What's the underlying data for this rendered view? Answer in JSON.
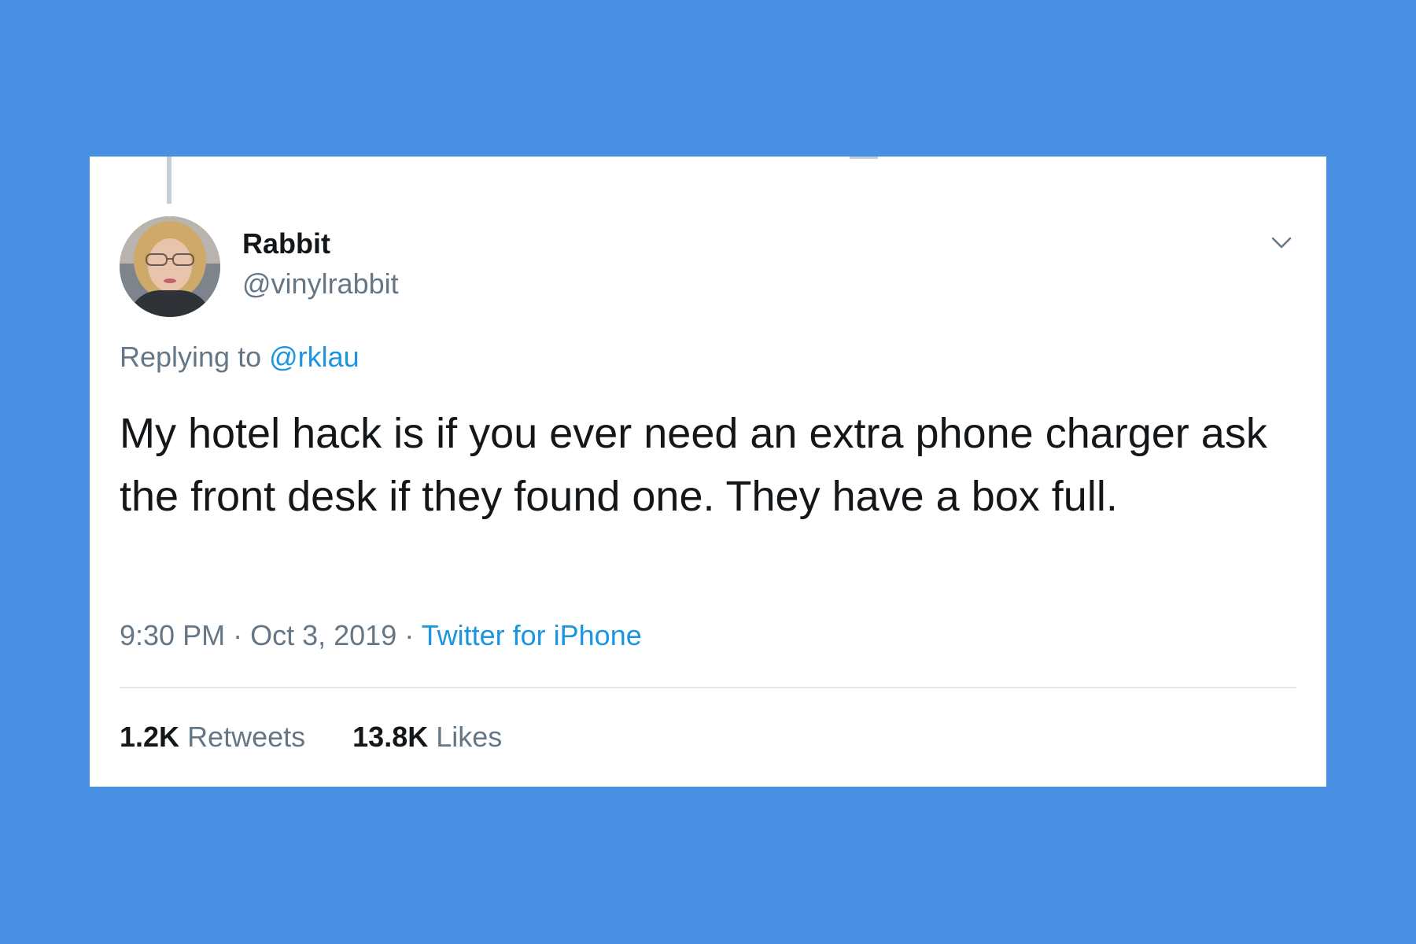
{
  "colors": {
    "background": "#4a90e2",
    "card": "#ffffff",
    "text_primary": "#14171a",
    "text_secondary": "#657786",
    "link": "#1b95e0",
    "divider": "#e1e8ed"
  },
  "tweet": {
    "author_name": "Rabbit",
    "author_handle": "@vinylrabbit",
    "reply_prefix": "Replying to",
    "reply_to": "@rklau",
    "text": "My hotel hack is if you ever need an extra phone charger ask the front desk if they found one. They have a box full.",
    "time": "9:30 PM",
    "separator": "·",
    "date": "Oct 3, 2019",
    "source": "Twitter for iPhone",
    "retweets_count": "1.2K",
    "retweets_label": "Retweets",
    "likes_count": "13.8K",
    "likes_label": "Likes"
  },
  "icons": {
    "menu": "chevron-down-icon",
    "avatar": "avatar-photo"
  }
}
